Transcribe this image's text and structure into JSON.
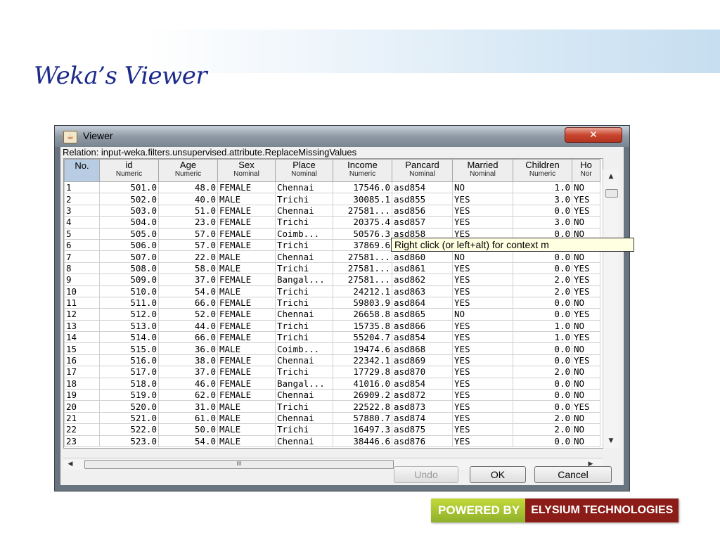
{
  "slide": {
    "title": "Weka’s Viewer"
  },
  "window": {
    "title": "Viewer",
    "close_icon": "close-icon",
    "relation_label": "Relation: input-weka.filters.unsupervised.attribute.ReplaceMissingValues"
  },
  "table": {
    "columns": [
      {
        "name": "No.",
        "type": ""
      },
      {
        "name": "id",
        "type": "Numeric"
      },
      {
        "name": "Age",
        "type": "Numeric"
      },
      {
        "name": "Sex",
        "type": "Nominal"
      },
      {
        "name": "Place",
        "type": "Nominal"
      },
      {
        "name": "Income",
        "type": "Numeric"
      },
      {
        "name": "Pancard",
        "type": "Nominal"
      },
      {
        "name": "Married",
        "type": "Nominal"
      },
      {
        "name": "Children",
        "type": "Numeric"
      },
      {
        "name": "Ho",
        "type": "Nor"
      }
    ],
    "rows": [
      [
        "1",
        "501.0",
        "48.0",
        "FEMALE",
        "Chennai",
        "17546.0",
        "asd854",
        "NO",
        "1.0",
        "NO"
      ],
      [
        "2",
        "502.0",
        "40.0",
        "MALE",
        "Trichi",
        "30085.1",
        "asd855",
        "YES",
        "3.0",
        "YES"
      ],
      [
        "3",
        "503.0",
        "51.0",
        "FEMALE",
        "Chennai",
        "27581...",
        "asd856",
        "YES",
        "0.0",
        "YES"
      ],
      [
        "4",
        "504.0",
        "23.0",
        "FEMALE",
        "Trichi",
        "20375.4",
        "asd857",
        "YES",
        "3.0",
        "NO"
      ],
      [
        "5",
        "505.0",
        "57.0",
        "FEMALE",
        "Coimb...",
        "50576.3",
        "asd858",
        "YES",
        "0.0",
        "NO"
      ],
      [
        "6",
        "506.0",
        "57.0",
        "FEMALE",
        "Trichi",
        "37869.6",
        "",
        "",
        "",
        ""
      ],
      [
        "7",
        "507.0",
        "22.0",
        "MALE",
        "Chennai",
        "27581...",
        "asd860",
        "NO",
        "0.0",
        "NO"
      ],
      [
        "8",
        "508.0",
        "58.0",
        "MALE",
        "Trichi",
        "27581...",
        "asd861",
        "YES",
        "0.0",
        "YES"
      ],
      [
        "9",
        "509.0",
        "37.0",
        "FEMALE",
        "Bangal...",
        "27581...",
        "asd862",
        "YES",
        "2.0",
        "YES"
      ],
      [
        "10",
        "510.0",
        "54.0",
        "MALE",
        "Trichi",
        "24212.1",
        "asd863",
        "YES",
        "2.0",
        "YES"
      ],
      [
        "11",
        "511.0",
        "66.0",
        "FEMALE",
        "Trichi",
        "59803.9",
        "asd864",
        "YES",
        "0.0",
        "NO"
      ],
      [
        "12",
        "512.0",
        "52.0",
        "FEMALE",
        "Chennai",
        "26658.8",
        "asd865",
        "NO",
        "0.0",
        "YES"
      ],
      [
        "13",
        "513.0",
        "44.0",
        "FEMALE",
        "Trichi",
        "15735.8",
        "asd866",
        "YES",
        "1.0",
        "NO"
      ],
      [
        "14",
        "514.0",
        "66.0",
        "FEMALE",
        "Trichi",
        "55204.7",
        "asd854",
        "YES",
        "1.0",
        "YES"
      ],
      [
        "15",
        "515.0",
        "36.0",
        "MALE",
        "Coimb...",
        "19474.6",
        "asd868",
        "YES",
        "0.0",
        "NO"
      ],
      [
        "16",
        "516.0",
        "38.0",
        "FEMALE",
        "Chennai",
        "22342.1",
        "asd869",
        "YES",
        "0.0",
        "YES"
      ],
      [
        "17",
        "517.0",
        "37.0",
        "FEMALE",
        "Trichi",
        "17729.8",
        "asd870",
        "YES",
        "2.0",
        "NO"
      ],
      [
        "18",
        "518.0",
        "46.0",
        "FEMALE",
        "Bangal...",
        "41016.0",
        "asd854",
        "YES",
        "0.0",
        "NO"
      ],
      [
        "19",
        "519.0",
        "62.0",
        "FEMALE",
        "Chennai",
        "26909.2",
        "asd872",
        "YES",
        "0.0",
        "NO"
      ],
      [
        "20",
        "520.0",
        "31.0",
        "MALE",
        "Trichi",
        "22522.8",
        "asd873",
        "YES",
        "0.0",
        "YES"
      ],
      [
        "21",
        "521.0",
        "61.0",
        "MALE",
        "Chennai",
        "57880.7",
        "asd874",
        "YES",
        "2.0",
        "NO"
      ],
      [
        "22",
        "522.0",
        "50.0",
        "MALE",
        "Trichi",
        "16497.3",
        "asd875",
        "YES",
        "2.0",
        "NO"
      ],
      [
        "23",
        "523.0",
        "54.0",
        "MALE",
        "Chennai",
        "38446.6",
        "asd876",
        "YES",
        "0.0",
        "NO"
      ]
    ]
  },
  "tooltip": {
    "text": "Right click (or left+alt) for context m"
  },
  "buttons": {
    "undo": "Undo",
    "ok": "OK",
    "cancel": "Cancel"
  },
  "scrollbar": {
    "thumb_grip": "III"
  },
  "brand": {
    "part1": "POWERED BY",
    "part2": "ELYSIUM TECHNOLOGIES"
  }
}
